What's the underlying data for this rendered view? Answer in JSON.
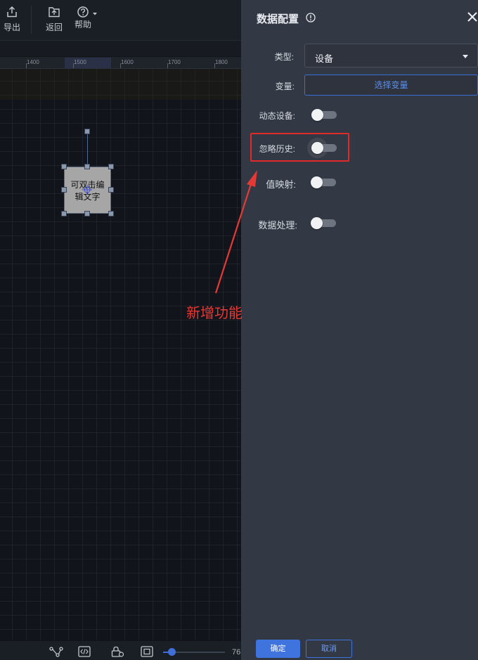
{
  "toolbar": {
    "export_label": "导出",
    "back_label": "返回",
    "help_label": "帮助"
  },
  "ruler": {
    "ticks": [
      "1400",
      "1500",
      "1600",
      "1700",
      "1800"
    ]
  },
  "node": {
    "text_line1": "可双击编",
    "text_line2": "辑文字"
  },
  "statusbar": {
    "zoom_value": "76"
  },
  "panel": {
    "title": "数据配置",
    "type_label": "类型:",
    "type_value": "设备",
    "variable_label": "变量:",
    "select_variable_button": "选择变量",
    "dynamic_device_label": "动态设备:",
    "ignore_history_label": "忽略历史:",
    "value_mapping_label": "值映射:",
    "data_processing_label": "数据处理:",
    "confirm_button": "确定",
    "cancel_button": "取消",
    "toggles": {
      "dynamic_device": false,
      "ignore_history": false,
      "value_mapping": false,
      "data_processing": false
    }
  },
  "annotation": {
    "text": "新增功能",
    "color": "#e53935"
  },
  "colors": {
    "accent": "#3f73dd",
    "panel_bg": "#333944",
    "canvas_bg": "#11151b",
    "highlight": "#e02a2a"
  }
}
